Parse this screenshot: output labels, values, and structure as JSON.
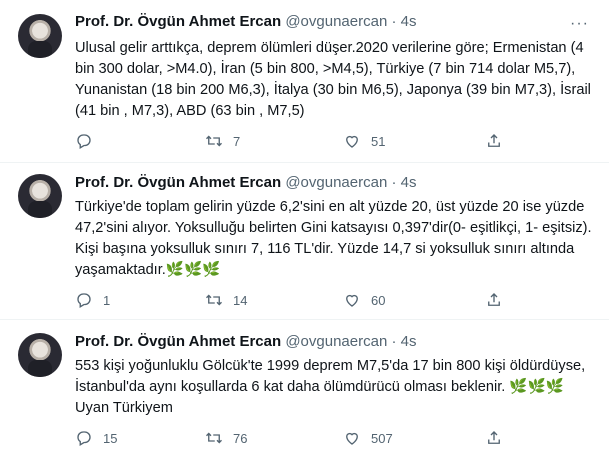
{
  "tweets": [
    {
      "author_name": "Prof. Dr. Övgün Ahmet Ercan",
      "handle": "@ovgunaercan",
      "separator": "·",
      "time": "4s",
      "text": "Ulusal gelir arttıkça, deprem ölümleri düşer.2020 verilerine göre; Ermenistan (4 bin 300 dolar, >M4.0), İran (5 bin 800, >M4,5), Türkiye (7 bin 714 dolar M5,7), Yunanistan (18 bin 200 M6,3), İtalya (30 bin M6,5), Japonya (39 bin M7,3), İsrail (41 bin , M7,3), ABD (63 bin , M7,5)",
      "replies": "",
      "retweets": "7",
      "likes": "51"
    },
    {
      "author_name": "Prof. Dr. Övgün Ahmet Ercan",
      "handle": "@ovgunaercan",
      "separator": "·",
      "time": "4s",
      "text": "Türkiye'de toplam gelirin yüzde 6,2'sini en alt yüzde 20, üst yüzde 20 ise yüzde 47,2'sini alıyor. Yoksulluğu belirten Gini katsayısı 0,397'dir(0- eşitlikçi, 1- eşitsiz). Kişi başına yoksulluk sınırı 7, 116 TL'dir. Yüzde 14,7 si yoksulluk sınırı altında yaşamaktadır.🌿🌿🌿",
      "replies": "1",
      "retweets": "14",
      "likes": "60"
    },
    {
      "author_name": "Prof. Dr. Övgün Ahmet Ercan",
      "handle": "@ovgunaercan",
      "separator": "·",
      "time": "4s",
      "text": "553 kişi yoğunluklu Gölcük'te 1999 deprem M7,5'da 17 bin 800 kişi öldürdüyse, İstanbul'da aynı koşullarda 6 kat daha ölümdürücü olması beklenir. 🌿🌿🌿 Uyan Türkiyem",
      "replies": "15",
      "retweets": "76",
      "likes": "507"
    }
  ],
  "more_glyph": "···",
  "icons": [
    "reply-icon",
    "retweet-icon",
    "like-icon",
    "share-icon",
    "more-icon"
  ]
}
